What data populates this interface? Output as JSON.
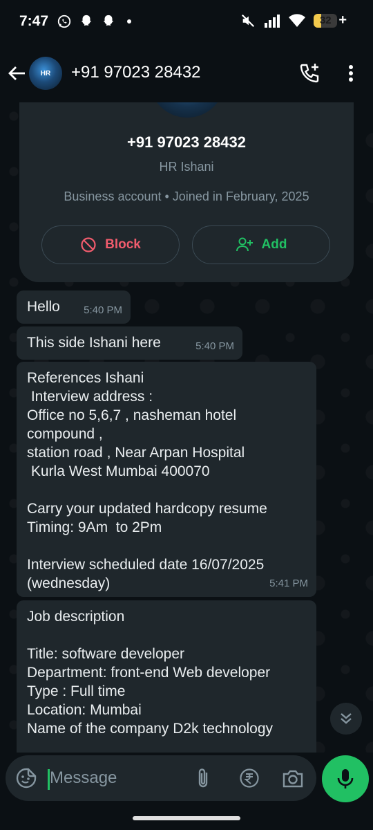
{
  "status_bar": {
    "time": "7:47",
    "battery": "32",
    "battery_level_percent": 32,
    "icons": [
      "whatsapp-icon",
      "snapchat-icon",
      "snapchat-icon",
      "notification-dot-icon",
      "mute-icon",
      "signal-icon",
      "wifi-icon",
      "battery-charging-icon"
    ]
  },
  "header": {
    "contact_name": "+91 97023 28432",
    "avatar_text": "HR"
  },
  "profile_card": {
    "phone": "+91 97023 28432",
    "name": "HR Ishani",
    "info": "Business account • Joined in February, 2025",
    "block_label": "Block",
    "add_label": "Add"
  },
  "messages": [
    {
      "text": "Hello",
      "time": "5:40 PM"
    },
    {
      "text": "This side Ishani here",
      "time": "5:40 PM"
    },
    {
      "text": "References Ishani\n Interview address :\nOffice no 5,6,7 , nasheman hotel\ncompound ,\nstation road , Near Arpan Hospital\n Kurla West Mumbai 400070\n\nCarry your updated hardcopy resume\nTiming: 9Am  to 2Pm\n\nInterview scheduled date 16/07/2025\n(wednesday)",
      "time": "5:41 PM"
    },
    {
      "text": "Job description\n\nTitle: software developer\nDepartment: front-end Web developer\nType : Full time\nLocation: Mumbai\nName of the company D2k technology",
      "time": ""
    }
  ],
  "composer": {
    "placeholder": "Message"
  },
  "colors": {
    "background": "#0b1014",
    "bubble": "#1f272c",
    "accent_green": "#21c063",
    "block_red": "#f15c6d",
    "muted_text": "#8696a0"
  }
}
